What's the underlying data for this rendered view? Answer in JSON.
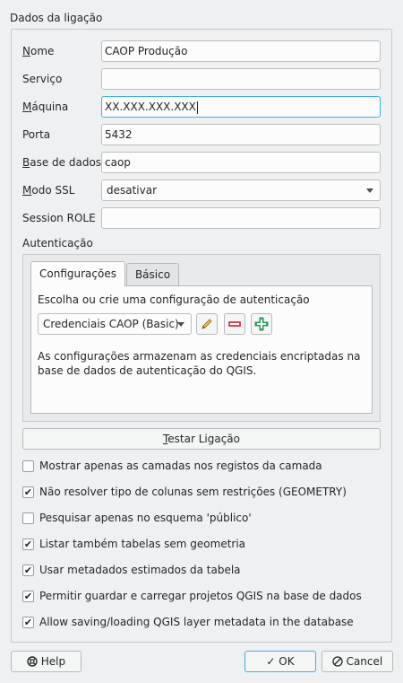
{
  "dialog_title": "Dados da ligação",
  "form": {
    "nome": {
      "label_u": "N",
      "label_rest": "ome",
      "value": "CAOP Produção"
    },
    "servico": {
      "label": "Serviço",
      "value": ""
    },
    "maquina": {
      "label_u": "M",
      "label_rest": "áquina",
      "value": "XX.XXX.XXX.XXX"
    },
    "porta": {
      "label": "Porta",
      "value": "5432"
    },
    "base_dados": {
      "label_u": "B",
      "label_rest": "ase de dados",
      "value": "caop"
    },
    "modo_ssl": {
      "label_u": "M",
      "label_rest": "odo SSL",
      "value": "desativar"
    },
    "session_role": {
      "label": "Session ROLE",
      "value": ""
    }
  },
  "auth": {
    "section_label": "Autenticação",
    "tabs": [
      "Configurações",
      "Básico"
    ],
    "prompt": "Escolha ou crie uma configuração de autenticação",
    "selected_config": "Credenciais CAOP (Basic)",
    "description": "As configurações armazenam as credenciais encriptadas na base de dados de autenticação do QGIS.",
    "icons": {
      "edit": "pencil-icon",
      "remove": "remove-icon",
      "add": "add-icon"
    }
  },
  "test_button": {
    "label_u": "T",
    "label_rest": "estar Ligação"
  },
  "options": [
    {
      "label": "Mostrar apenas as camadas nos registos da camada",
      "checked": false
    },
    {
      "label": "Não resolver tipo de colunas sem restrições (GEOMETRY)",
      "checked": true
    },
    {
      "label": "Pesquisar apenas no esquema 'público'",
      "checked": false
    },
    {
      "label": "Listar também tabelas sem geometria",
      "checked": true
    },
    {
      "label": "Usar metadados estimados da tabela",
      "checked": true
    },
    {
      "label": "Permitir guardar e carregar projetos QGIS na base de dados",
      "checked": true
    },
    {
      "label": "Allow saving/loading QGIS layer metadata in the database",
      "checked": true
    }
  ],
  "buttons": {
    "help": "Help",
    "ok": "OK",
    "cancel": "Cancel"
  },
  "colors": {
    "accent": "#3daee9",
    "window": "#eff0f1",
    "field": "#fcfcfc",
    "remove_red": "#da4453",
    "add_green": "#27ae60"
  }
}
